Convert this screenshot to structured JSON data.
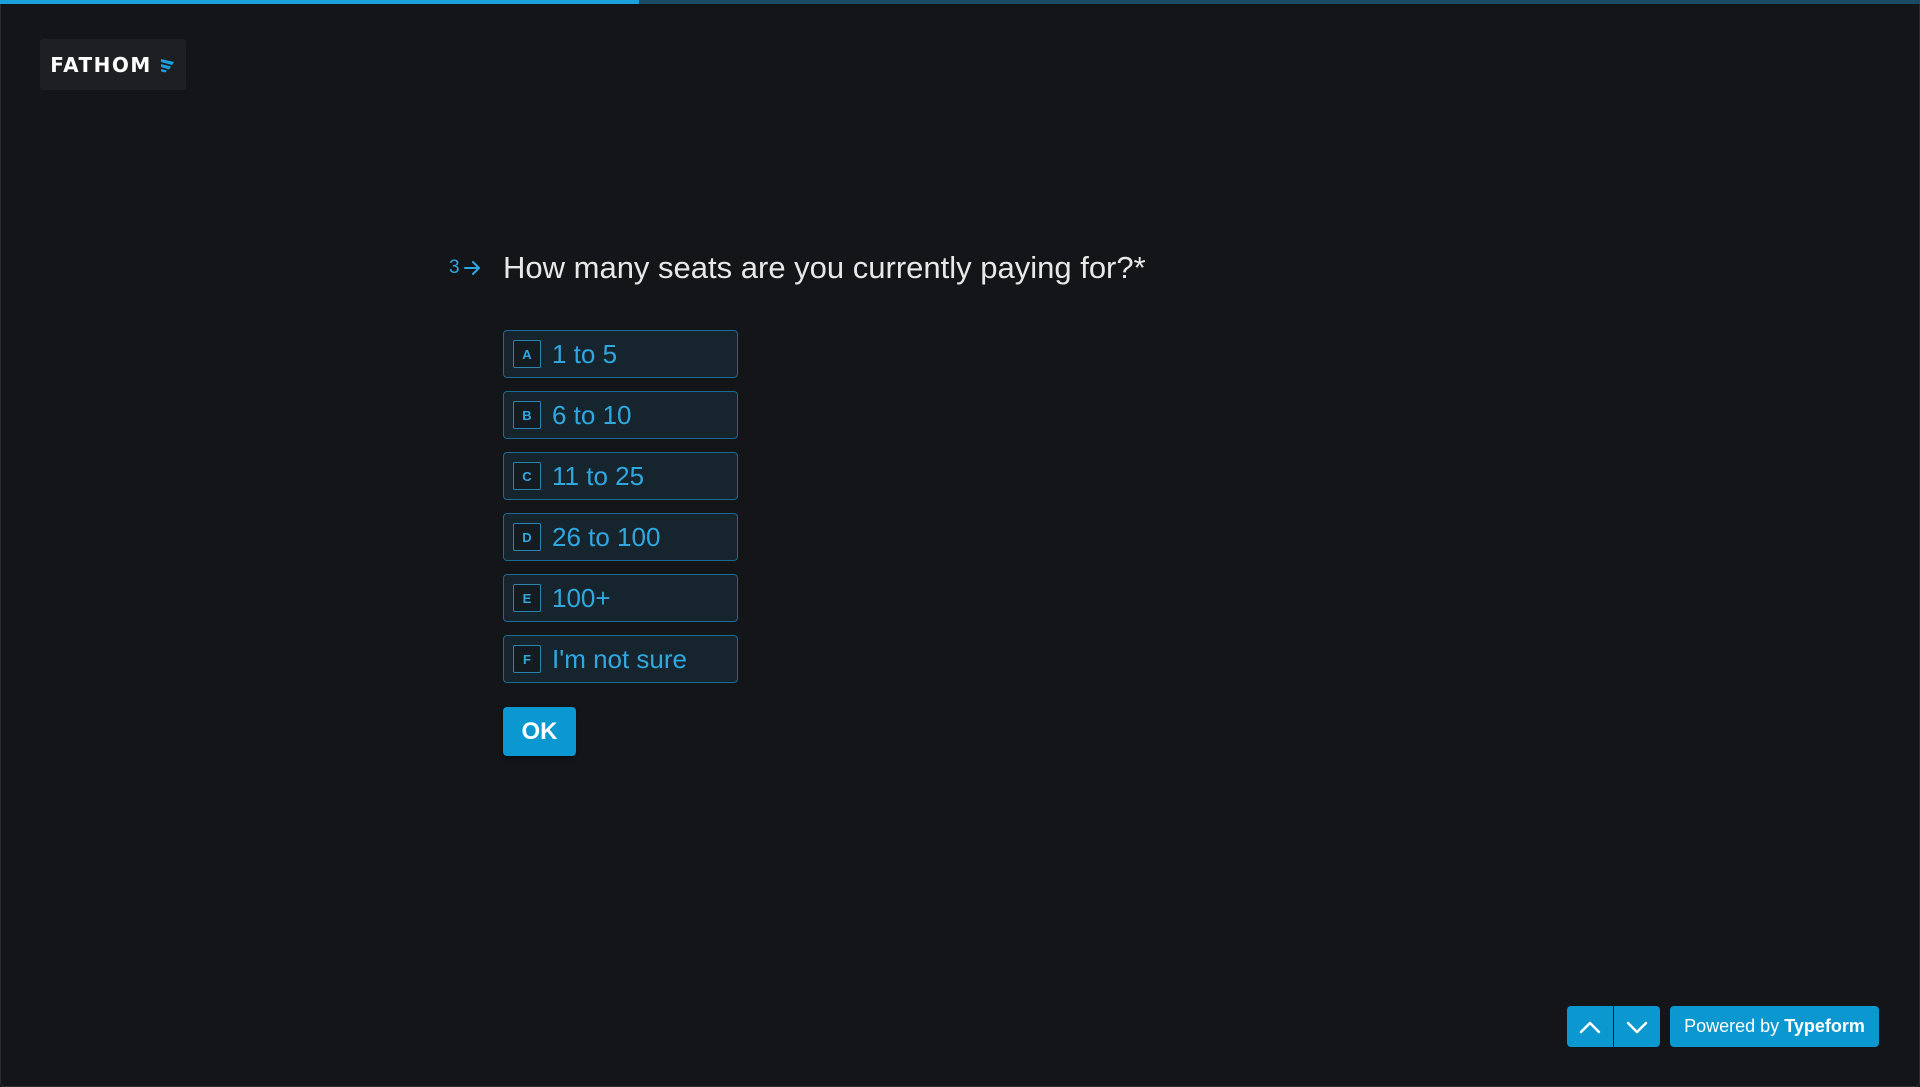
{
  "progress": {
    "fraction": 0.333
  },
  "logo": {
    "text": "FATHOM",
    "icon": "fathom-logo-mark"
  },
  "question": {
    "number": "3",
    "arrow_icon": "arrow-right-icon",
    "text": "How many seats are you currently paying for?*"
  },
  "choices": [
    {
      "key": "A",
      "label": "1 to 5"
    },
    {
      "key": "B",
      "label": "6 to 10"
    },
    {
      "key": "C",
      "label": "11 to 25"
    },
    {
      "key": "D",
      "label": "26 to 100"
    },
    {
      "key": "E",
      "label": "100+"
    },
    {
      "key": "F",
      "label": "I'm not sure"
    }
  ],
  "ok_button": {
    "label": "OK"
  },
  "navigation": {
    "up_icon": "chevron-up-icon",
    "down_icon": "chevron-down-icon"
  },
  "powered_by": {
    "prefix": "Powered by",
    "brand": "Typeform"
  },
  "colors": {
    "background": "#141518",
    "accent": "#0b97cf",
    "choice_text": "#2fa8e0",
    "question_text": "#e8e8e8"
  }
}
